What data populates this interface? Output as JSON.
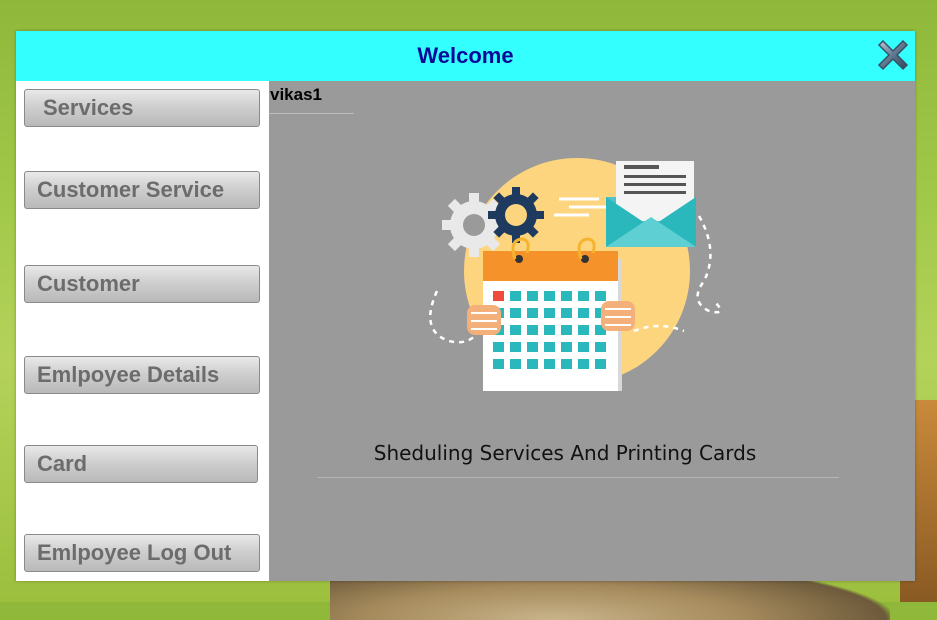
{
  "window": {
    "title": "Welcome"
  },
  "sidebar": {
    "items": [
      {
        "label": "Services"
      },
      {
        "label": "Customer Service"
      },
      {
        "label": "Customer"
      },
      {
        "label": "Emlpoyee Details"
      },
      {
        "label": "Card"
      },
      {
        "label": "Emlpoyee Log Out"
      }
    ]
  },
  "main": {
    "username": "vikas1",
    "tagline": "Sheduling Services And Printing Cards"
  },
  "colors": {
    "titlebar": "#33ffff",
    "title_text": "#0a0a9a",
    "main_panel": "#9a9a9a",
    "button_text": "#6c6c6c"
  },
  "icons": [
    "close-icon",
    "schedule-illustration"
  ]
}
